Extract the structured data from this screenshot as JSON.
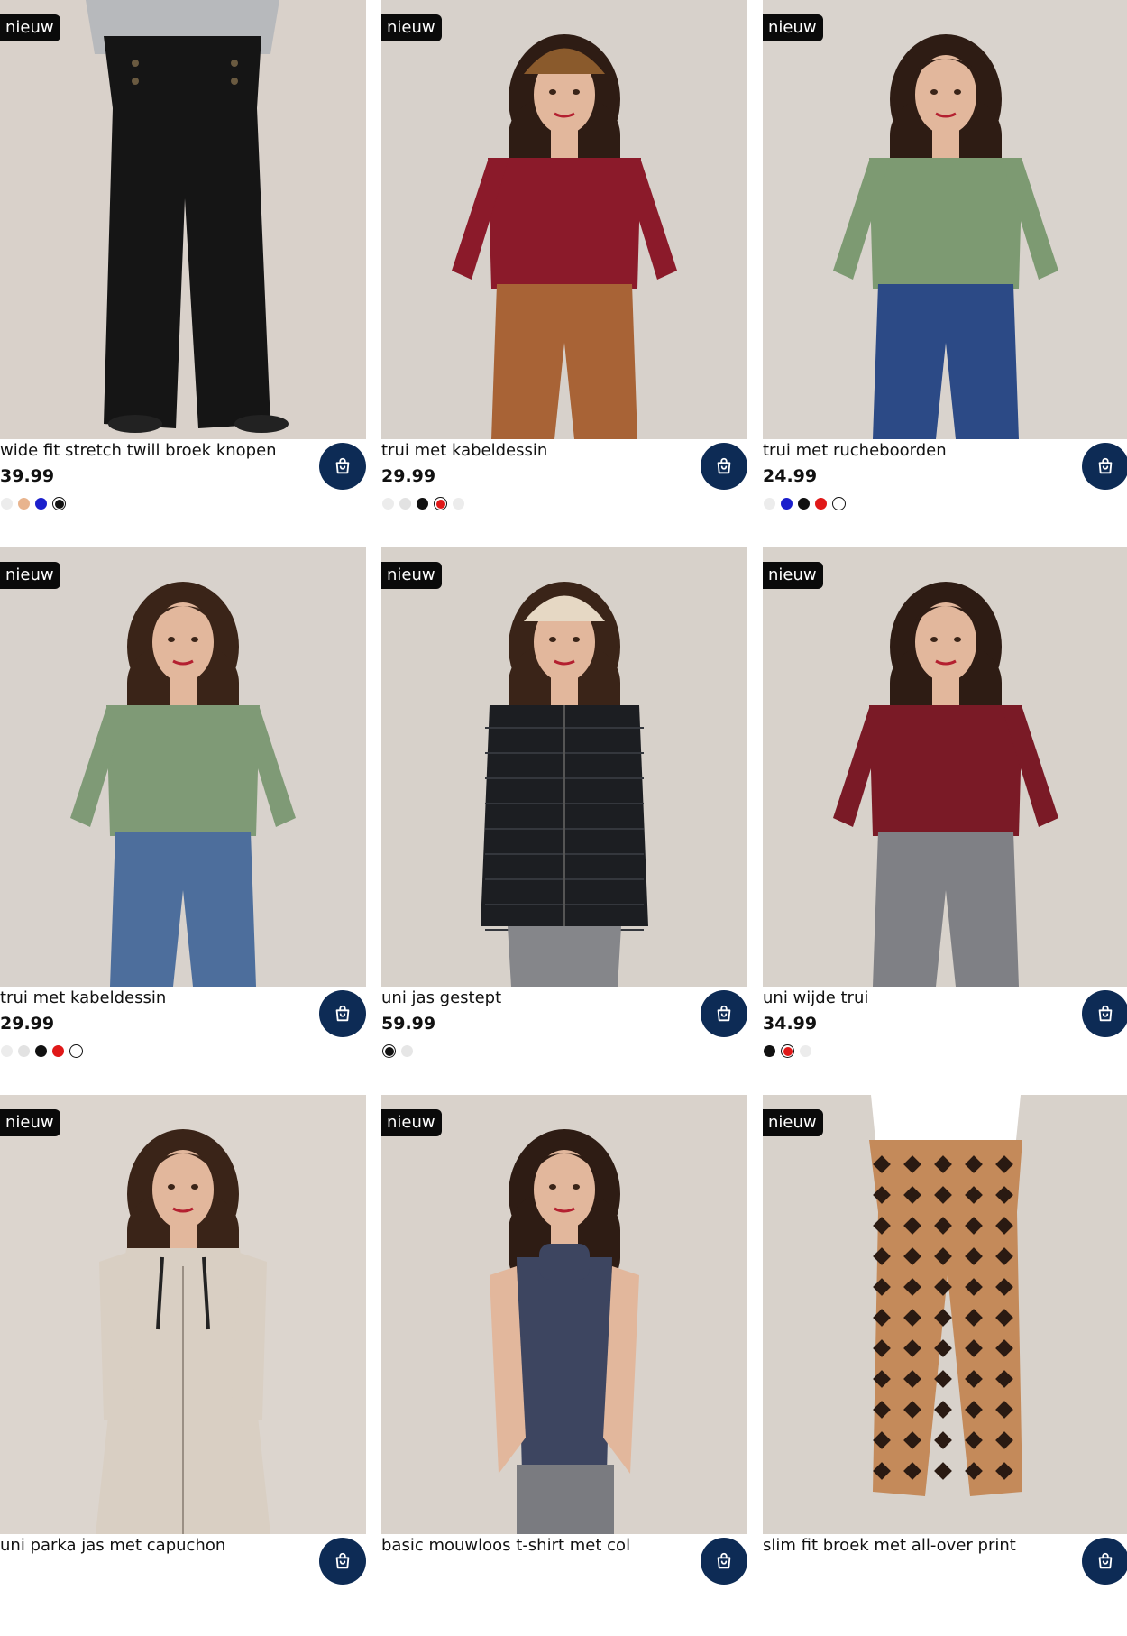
{
  "products": [
    {
      "badge": "nieuw",
      "title": "wide fit stretch twill broek knopen",
      "price": "39.99",
      "swatches": [
        {
          "color": "#ececec",
          "selected": false
        },
        {
          "color": "#e8b48e",
          "selected": false
        },
        {
          "color": "#1b1fcc",
          "selected": false
        },
        {
          "color": "#111111",
          "selected": true
        }
      ],
      "illustration": {
        "bg": "#d9d1ca",
        "top": "#b7b9bc",
        "bottom": "#151515",
        "skin": "#e2b79c",
        "hair": "#3b2519",
        "outfit": "flared-pants",
        "cropped_head": true
      }
    },
    {
      "badge": "nieuw",
      "title": "trui met kabeldessin",
      "price": "29.99",
      "swatches": [
        {
          "color": "#ececec",
          "selected": false
        },
        {
          "color": "#e2e2e2",
          "selected": false
        },
        {
          "color": "#111111",
          "selected": false
        },
        {
          "color": "#e01818",
          "selected": true
        },
        {
          "color": "#ececec",
          "selected": false
        }
      ],
      "illustration": {
        "bg": "#d7d1cb",
        "top": "#8b1a2a",
        "bottom": "#a86336",
        "skin": "#e2b79c",
        "hair": "#2e1c14",
        "outfit": "sweater-pants",
        "hat": "#8a5a2c"
      }
    },
    {
      "badge": "nieuw",
      "title": "trui met rucheboorden",
      "price": "24.99",
      "swatches": [
        {
          "color": "#ececec",
          "selected": false
        },
        {
          "color": "#1b1fcc",
          "selected": false
        },
        {
          "color": "#111111",
          "selected": false
        },
        {
          "color": "#e01818",
          "selected": false
        },
        {
          "color": "#ffffff",
          "selected": true
        }
      ],
      "illustration": {
        "bg": "#d9d3cd",
        "top": "#7d9a72",
        "bottom": "#2c4a86",
        "skin": "#e2b79c",
        "hair": "#2e1c14",
        "outfit": "sweater-pants"
      }
    },
    {
      "badge": "nieuw",
      "title": "trui met kabeldessin",
      "price": "29.99",
      "swatches": [
        {
          "color": "#ececec",
          "selected": false
        },
        {
          "color": "#e2e2e2",
          "selected": false
        },
        {
          "color": "#111111",
          "selected": false
        },
        {
          "color": "#e01818",
          "selected": false
        },
        {
          "color": "#ffffff",
          "selected": true
        }
      ],
      "illustration": {
        "bg": "#d8d2cc",
        "top": "#7f9a76",
        "bottom": "#4d6e9c",
        "skin": "#e2b79c",
        "hair": "#3a2418",
        "outfit": "sweater-pants"
      }
    },
    {
      "badge": "nieuw",
      "title": "uni jas gestept",
      "price": "59.99",
      "swatches": [
        {
          "color": "#111111",
          "selected": true
        },
        {
          "color": "#e6e6e6",
          "selected": false
        }
      ],
      "illustration": {
        "bg": "#d7d1ca",
        "top": "#1c1e22",
        "bottom": "#85868a",
        "skin": "#e2b79c",
        "hair": "#3a2418",
        "outfit": "jacket-pants",
        "hat": "#e6d8c4"
      }
    },
    {
      "badge": "nieuw",
      "title": "uni wijde trui",
      "price": "34.99",
      "swatches": [
        {
          "color": "#111111",
          "selected": false
        },
        {
          "color": "#e01818",
          "selected": true
        },
        {
          "color": "#ececec",
          "selected": false
        }
      ],
      "illustration": {
        "bg": "#d8d2cb",
        "top": "#7a1a26",
        "bottom": "#7f8085",
        "skin": "#e2b79c",
        "hair": "#2e1c14",
        "outfit": "sweater-pants"
      }
    },
    {
      "badge": "nieuw",
      "title": "uni parka jas met capuchon",
      "price": "",
      "swatches": [],
      "illustration": {
        "bg": "#dcd5ce",
        "top": "#d9cfc3",
        "bottom": "#5a7fb0",
        "skin": "#e2b79c",
        "hair": "#3a2418",
        "outfit": "parka"
      }
    },
    {
      "badge": "nieuw",
      "title": "basic mouwloos t-shirt met col",
      "price": "",
      "swatches": [],
      "illustration": {
        "bg": "#d9d2cb",
        "top": "#3d4560",
        "bottom": "#7a7b80",
        "skin": "#e2b79c",
        "hair": "#2e1c14",
        "outfit": "sleeveless"
      }
    },
    {
      "badge": "nieuw",
      "title": "slim fit broek met all-over print",
      "price": "",
      "swatches": [],
      "illustration": {
        "bg": "#d8d2cb",
        "top": "#ffffff",
        "bottom": "#c48a5a",
        "skin": "#e2b79c",
        "hair": "#2e1c14",
        "outfit": "print-pants",
        "cropped_head": true
      }
    }
  ]
}
